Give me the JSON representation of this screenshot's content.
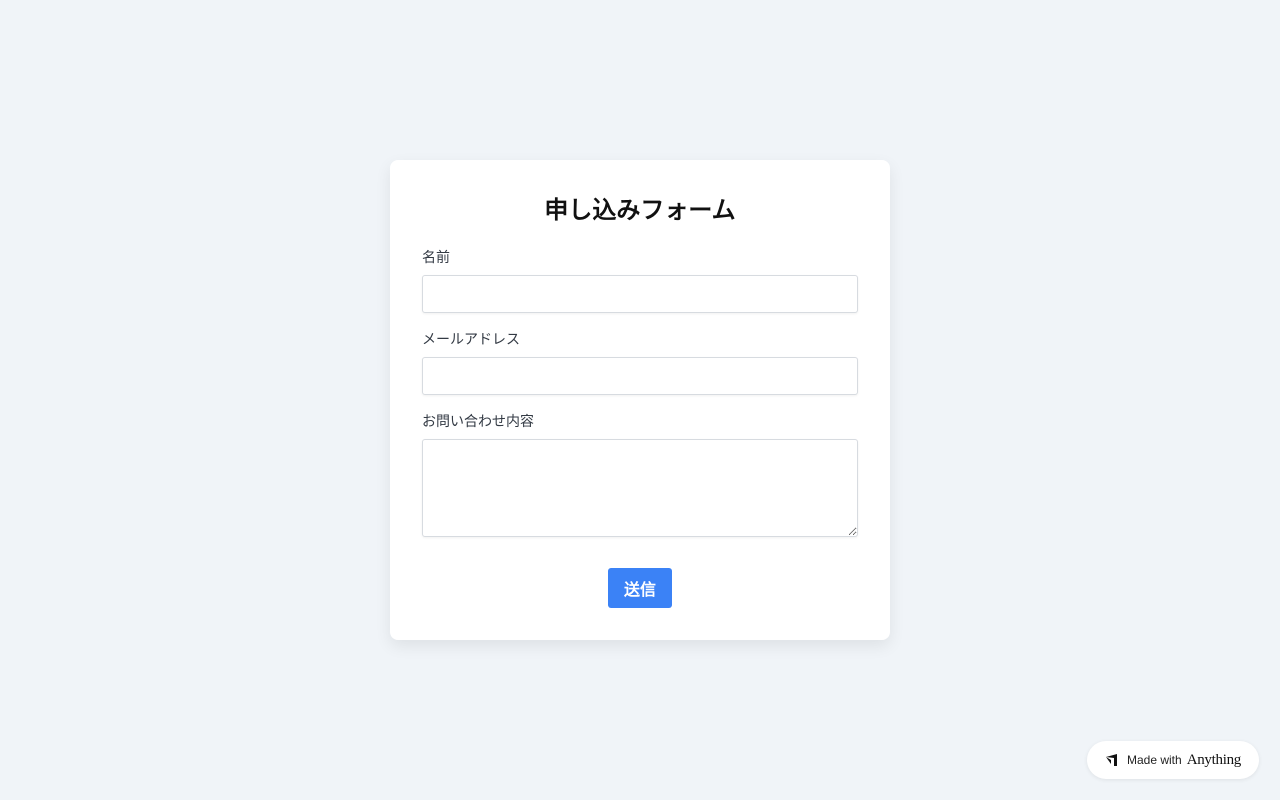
{
  "form": {
    "title": "申し込みフォーム",
    "fields": {
      "name": {
        "label": "名前",
        "value": "",
        "placeholder": ""
      },
      "email": {
        "label": "メールアドレス",
        "value": "",
        "placeholder": ""
      },
      "message": {
        "label": "お問い合わせ内容",
        "value": "",
        "placeholder": ""
      }
    },
    "submit_label": "送信"
  },
  "badge": {
    "made_text": "Made with",
    "brand": "Anything",
    "icon": "anything-logo-icon"
  },
  "colors": {
    "page_background": "#f0f4f8",
    "card_background": "#ffffff",
    "accent": "#3b82f6"
  }
}
